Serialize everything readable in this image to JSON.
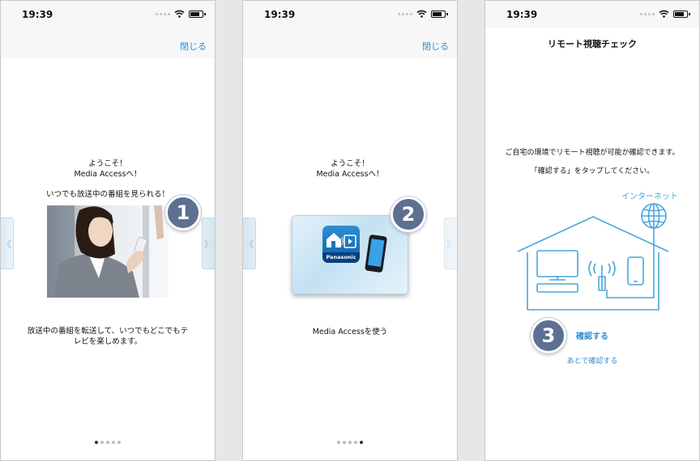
{
  "status": {
    "time": "19:39"
  },
  "screens": [
    {
      "close_label": "閉じる",
      "welcome_line1": "ようこそ！",
      "welcome_line2": "Media Accessへ！",
      "tagline": "いつでも放送中の番組を見られる！",
      "badge": "1",
      "description_line1": "放送中の番組を転送して、いつでもどこでもテ",
      "description_line2": "レビを楽しめます。",
      "arrow_left": "《",
      "arrow_right": "》",
      "page_index": 1,
      "page_count": 5
    },
    {
      "close_label": "閉じる",
      "welcome_line1": "ようこそ！",
      "welcome_line2": "Media Accessへ！",
      "badge": "2",
      "app_icon_label": "Panasonic",
      "action_text": "Media Accessを使う",
      "arrow_left": "《",
      "arrow_right": "》",
      "page_index": 5,
      "page_count": 5
    },
    {
      "title": "リモート視聴チェック",
      "instruction_line1": "ご自宅の環境でリモート視聴が可能か確認できます。",
      "instruction_line2": "「確認する」をタップしてください。",
      "internet_label": "インターネット",
      "badge": "3",
      "confirm_label": "確認する",
      "later_label": "あとで確認する"
    }
  ],
  "colors": {
    "accent": "#2f8fd3",
    "badge": "#5d7092",
    "diagram_line": "#4aa6dc"
  }
}
